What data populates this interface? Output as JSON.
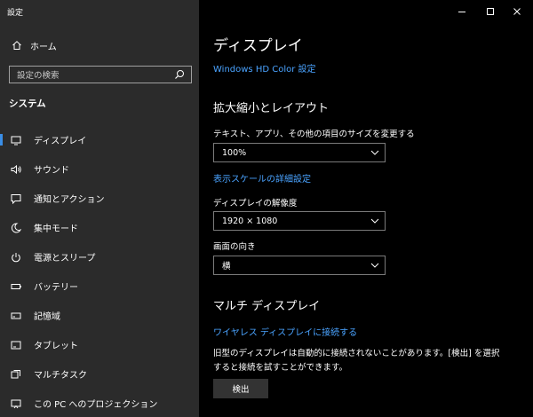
{
  "window": {
    "title": "設定",
    "controls": [
      "minimize-icon",
      "maximize-icon",
      "close-icon"
    ]
  },
  "sidebar": {
    "home_label": "ホーム",
    "search_placeholder": "設定の検索",
    "section_title": "システム",
    "items": [
      {
        "label": "ディスプレイ",
        "icon": "monitor-icon",
        "selected": true
      },
      {
        "label": "サウンド",
        "icon": "speaker-icon"
      },
      {
        "label": "通知とアクション",
        "icon": "message-icon"
      },
      {
        "label": "集中モード",
        "icon": "moon-icon"
      },
      {
        "label": "電源とスリープ",
        "icon": "power-icon"
      },
      {
        "label": "バッテリー",
        "icon": "battery-icon"
      },
      {
        "label": "記憶域",
        "icon": "storage-icon"
      },
      {
        "label": "タブレット",
        "icon": "tablet-icon"
      },
      {
        "label": "マルチタスク",
        "icon": "multitask-icon"
      },
      {
        "label": "この PC へのプロジェクション",
        "icon": "projection-icon"
      }
    ],
    "accent_color": "#3a8ee6"
  },
  "main": {
    "title": "ディスプレイ",
    "hd_color_link": "Windows HD Color 設定",
    "scale_heading": "拡大縮小とレイアウト",
    "scale_label": "テキスト、アプリ、その他の項目のサイズを変更する",
    "scale_value": "100%",
    "advanced_scale_link": "表示スケールの詳細設定",
    "resolution_label": "ディスプレイの解像度",
    "resolution_value": "1920 × 1080",
    "orientation_label": "画面の向き",
    "orientation_value": "横",
    "multi_heading": "マルチ ディスプレイ",
    "wireless_link": "ワイヤレス ディスプレイに接続する",
    "detect_text": "旧型のディスプレイは自動的に接続されないことがあります。[検出] を選択すると接続を試すことができます。",
    "detect_button": "検出",
    "link_color": "#4aa3ff"
  }
}
